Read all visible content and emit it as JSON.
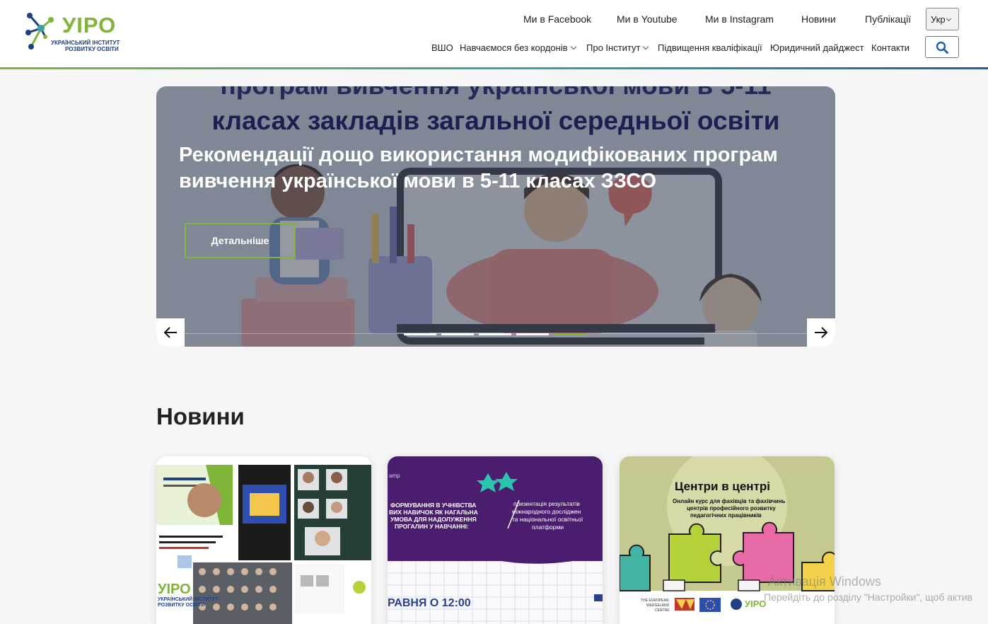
{
  "header": {
    "logo": {
      "word": "УІРО",
      "subtitle_line1": "УКРАЇНСЬКИЙ ІНСТИТУТ",
      "subtitle_line2": "РОЗВИТКУ ОСВІТИ",
      "icon": "molecule-logo-icon"
    },
    "social_links": [
      {
        "label": "Ми в Facebook"
      },
      {
        "label": "Ми в Youtube"
      },
      {
        "label": "Ми в Instagram"
      },
      {
        "label": "Новини"
      },
      {
        "label": "Публікації"
      }
    ],
    "nav": [
      {
        "label": "ВШО"
      },
      {
        "label": "Навчаємося без кордонів",
        "has_dropdown": true
      },
      {
        "label": "Про Інститут",
        "has_dropdown": true
      },
      {
        "label": "Підвищення кваліфікації"
      },
      {
        "label": "Юридичний дайджест"
      },
      {
        "label": "Контакти"
      }
    ],
    "language": {
      "selected": "Укр"
    },
    "search_icon": "search-icon"
  },
  "hero": {
    "background_text_line1": "програм вивчення української мови в 5-11",
    "background_text_line2": "класах закладів загальної середньої освіти",
    "title": "Рекомендації дощо використання модифікованих програм вивчення української мови в 5-11 класах ЗЗСО",
    "button_label": "Детальніше",
    "slide_count": 5,
    "active_slide": 5,
    "prev_icon": "arrow-left-icon",
    "next_icon": "arrow-right-icon"
  },
  "news": {
    "title": "Новини",
    "cards": [
      {
        "texts": [
          "УІРО",
          "УКРАЇНСЬКИЙ ІНСТИТУТ",
          "РОЗВИТКУ ОСВІТИ"
        ]
      },
      {
        "texts": [
          "ФОРМУВАННЯ В УЧНІВСТВА",
          "ВИХ НАВИЧОК ЯК НАГАЛЬНА",
          "УМОВА ДЛЯ НАДОЛУЖЕННЯ",
          "ПРОГАЛИН У НАВЧАННІ:",
          "презентація результатів",
          "міжнародного досліджен",
          "та національної освітньої",
          "платформи",
          "РАВНЯ  О 12:00"
        ]
      },
      {
        "texts": [
          "Центри в центрі",
          "Онлайн курс для фахівців та фахівчинь",
          "центрів професійного розвитку",
          "педагогічних працівників",
          "THE EUROPEAN",
          "WERGELAND",
          "CENTRE",
          "УІРО"
        ]
      }
    ]
  },
  "system_watermark": {
    "line1": "Активація Windows",
    "line2": "Перейдіть до розділу \"Настройки\", щоб актив"
  },
  "colors": {
    "brand_green": "#7fb539",
    "brand_blue": "#1f3f87",
    "overlay": "#3c4655",
    "card2_purple": "#4a1d6e",
    "card3_olive": "#c5c98f"
  }
}
